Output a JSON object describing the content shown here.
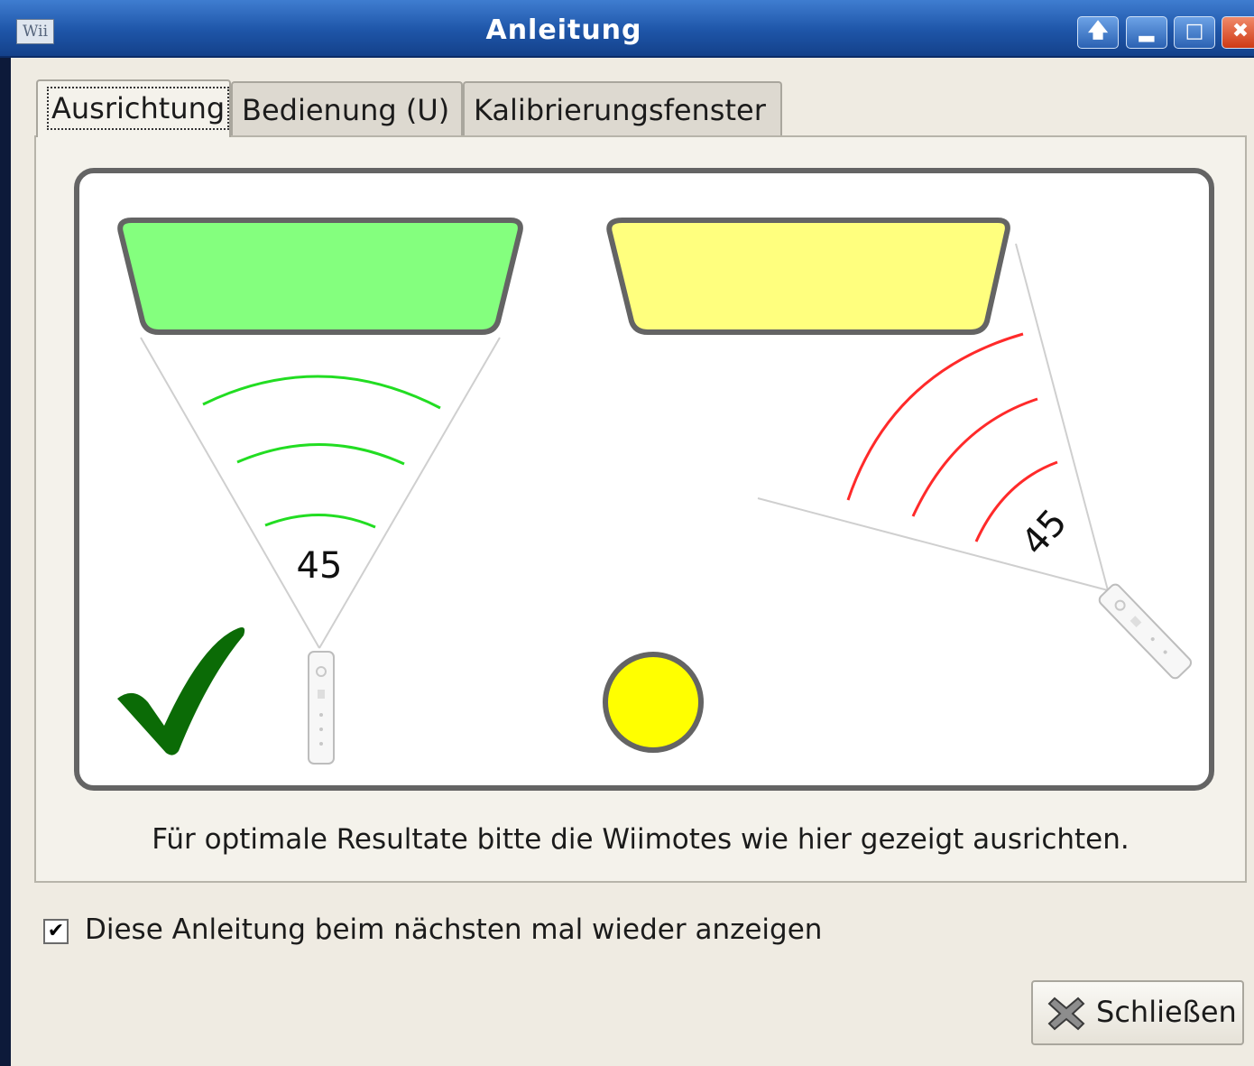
{
  "window": {
    "title": "Anleitung",
    "icon_label": "Wii",
    "buttons": [
      "up-arrow-icon",
      "minimize-icon",
      "maximize-icon",
      "close-icon"
    ]
  },
  "tabs": [
    {
      "label": "Ausrichtung",
      "active": true
    },
    {
      "label": "Bedienung (U)",
      "active": false
    },
    {
      "label": "Kalibrierungsfenster",
      "active": false
    }
  ],
  "illustration": {
    "left_angle": "45",
    "right_angle": "45",
    "colors": {
      "good_screen": "#84ff7e",
      "warn_screen": "#ffff7e",
      "good_waves": "#22dd22",
      "bad_waves": "#ff2a2a",
      "check": "#0b6b06",
      "sensor": "#ffff00"
    }
  },
  "caption": "Für optimale Resultate bitte die Wiimotes wie hier gezeigt ausrichten.",
  "show_again": {
    "checked": true,
    "label": "Diese Anleitung beim nächsten mal wieder anzeigen"
  },
  "close_button": {
    "label": "Schließen"
  }
}
